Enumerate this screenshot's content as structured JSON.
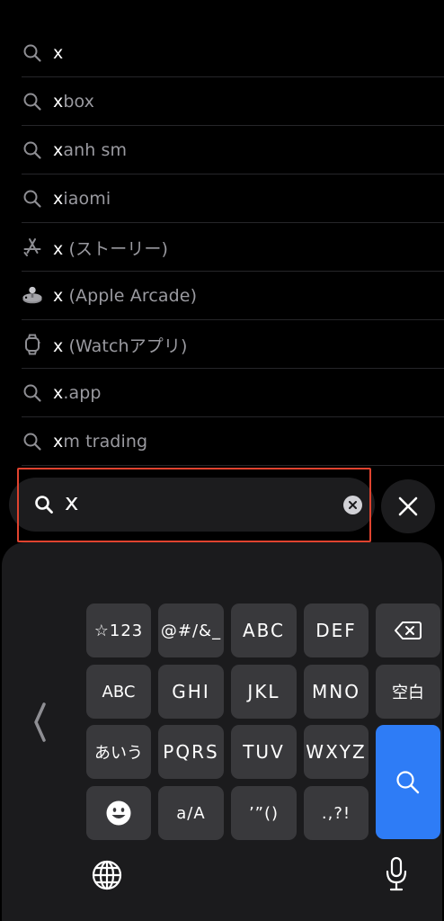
{
  "suggestions": [
    {
      "icon": "search-icon",
      "typed": "x",
      "rest": ""
    },
    {
      "icon": "search-icon",
      "typed": "x",
      "rest": "box"
    },
    {
      "icon": "search-icon",
      "typed": "x",
      "rest": "anh sm"
    },
    {
      "icon": "search-icon",
      "typed": "x",
      "rest": "iaomi"
    },
    {
      "icon": "app-store-icon",
      "typed": "x",
      "rest": " (ストーリー)"
    },
    {
      "icon": "arcade-joystick-icon",
      "typed": "x",
      "rest": " (Apple Arcade)"
    },
    {
      "icon": "watch-icon",
      "typed": "x",
      "rest": " (Watchアプリ)"
    },
    {
      "icon": "search-icon",
      "typed": "x",
      "rest": ".app"
    },
    {
      "icon": "search-icon",
      "typed": "x",
      "rest": "m trading"
    }
  ],
  "search": {
    "query": "x"
  },
  "keyboard": {
    "row1": [
      "☆123",
      "@#/&_",
      "ABC",
      "DEF"
    ],
    "row2": [
      "ABC",
      "GHI",
      "JKL",
      "MNO",
      "空白"
    ],
    "row3": [
      "あいう",
      "PQRS",
      "TUV",
      "WXYZ"
    ],
    "row4": [
      "a/A",
      "’”()",
      ".,?!"
    ]
  },
  "colors": {
    "accent": "#2e7cf6",
    "highlight": "#e0432f"
  }
}
